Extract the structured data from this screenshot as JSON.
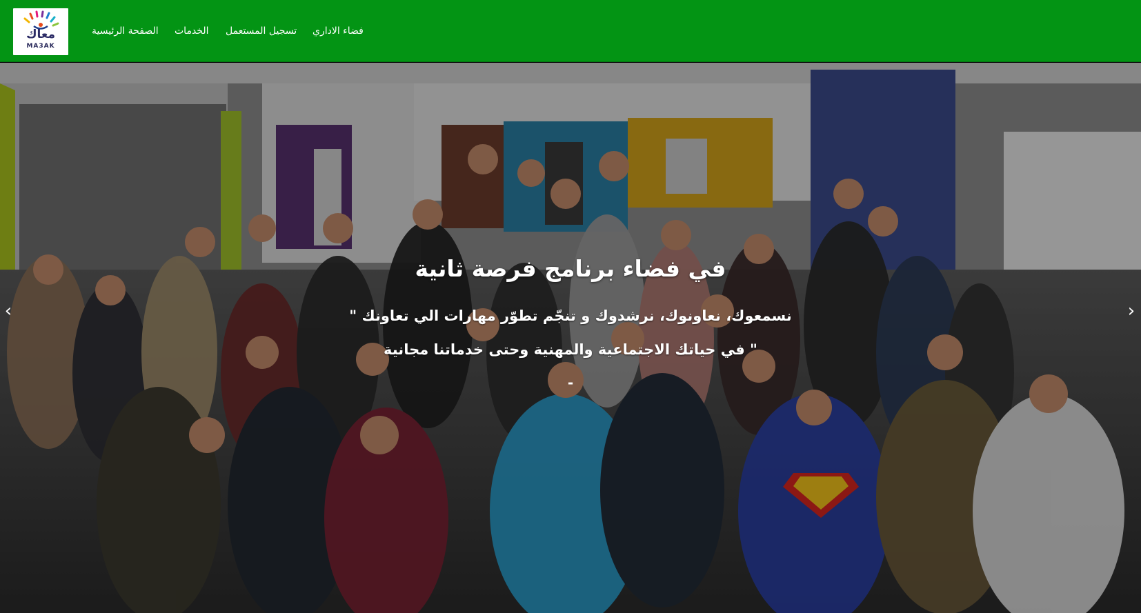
{
  "brand": {
    "logo_arabic": "معاك",
    "logo_latin": "MA3AK"
  },
  "nav": {
    "items": [
      {
        "label": "الصفحة الرئيسية"
      },
      {
        "label": "الخدمات"
      },
      {
        "label": "تسجيل المستعمل"
      },
      {
        "label": "فضاء الاداري"
      }
    ]
  },
  "hero": {
    "title": "في فضاء برنامج فرصة ثانية",
    "line1": "نسمعوك، نعاونوك، نرشدوك و تنجّم تطوّر مهارات الي تعاونك \"",
    "line2": "\" في حياتك الاجتماعية والمهنية وحتى خدماتنا مجانية",
    "dash": "-",
    "prev_icon": "chevron-left-icon",
    "next_icon": "chevron-right-icon"
  },
  "colors": {
    "navbar": "#039414",
    "text": "#ffffff"
  }
}
